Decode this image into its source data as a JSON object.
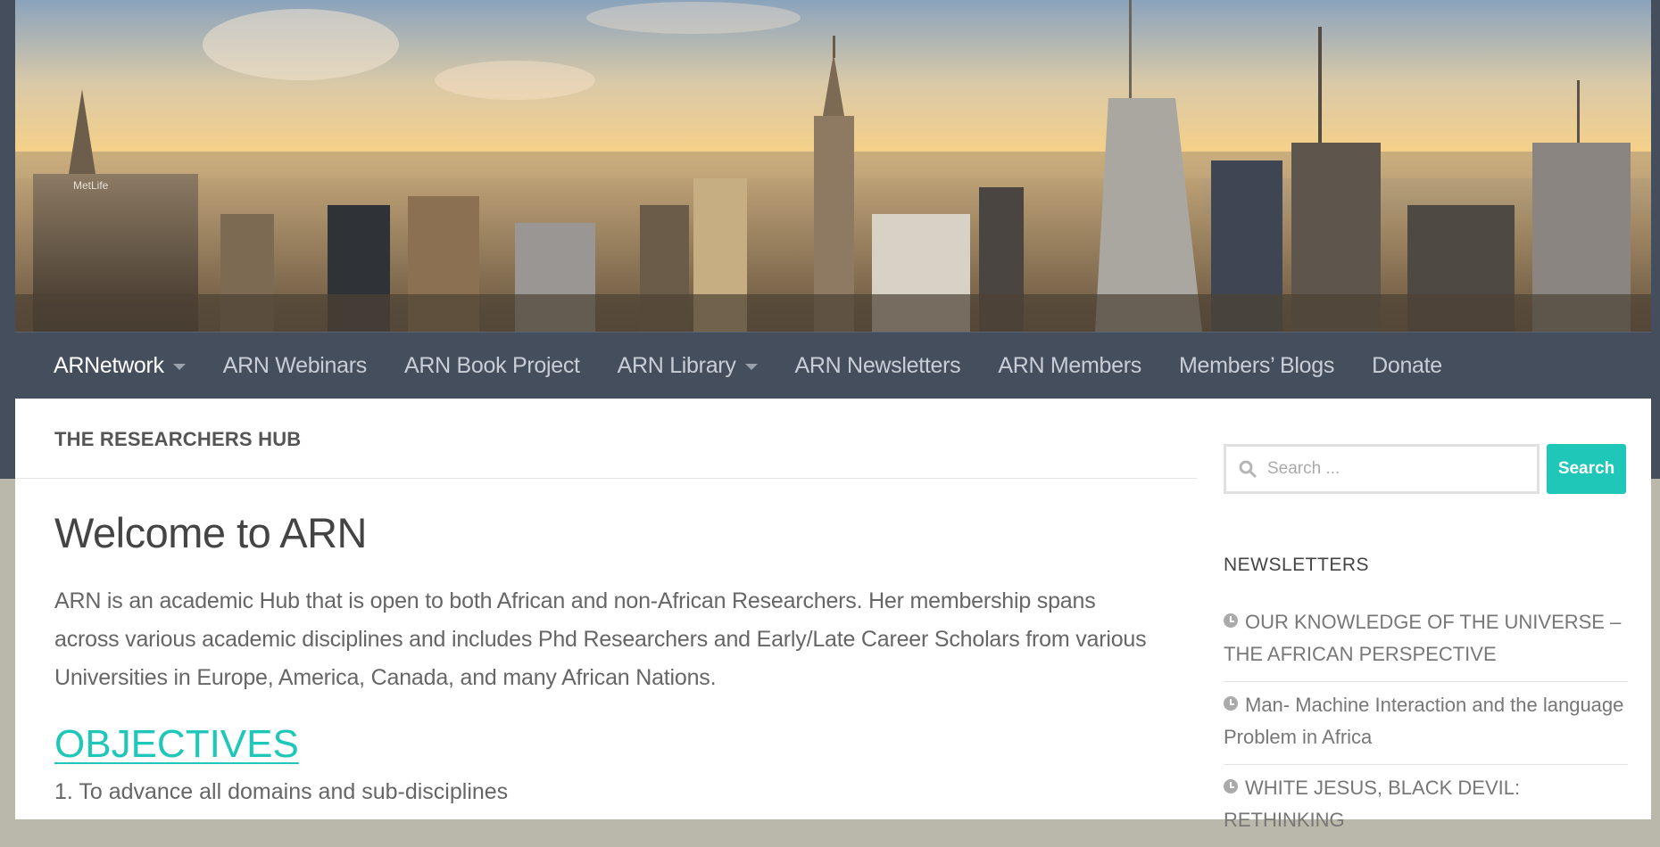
{
  "banner": {
    "logo_text": "MetLife"
  },
  "nav": {
    "items": [
      {
        "label": "ARNetwork",
        "dropdown": true,
        "active": true
      },
      {
        "label": "ARN Webinars",
        "dropdown": false
      },
      {
        "label": "ARN Book Project",
        "dropdown": false
      },
      {
        "label": "ARN Library",
        "dropdown": true
      },
      {
        "label": "ARN Newsletters",
        "dropdown": false
      },
      {
        "label": "ARN Members",
        "dropdown": false
      },
      {
        "label": "Members’ Blogs",
        "dropdown": false
      },
      {
        "label": "Donate",
        "dropdown": false
      }
    ]
  },
  "hub": {
    "title": "THE RESEARCHERS HUB"
  },
  "main": {
    "title": "Welcome to ARN",
    "intro": "ARN is an academic Hub that is open to both African and non-African Researchers. Her membership spans across various academic disciplines and  includes Phd Researchers and Early/Late Career Scholars from various Universities in Europe, America, Canada, and many African Nations.",
    "objectives_heading": "OBJECTIVES",
    "list_first": "1.  To advance all domains and sub-disciplines"
  },
  "sidebar": {
    "search": {
      "placeholder": "Search ...",
      "button": "Search"
    },
    "newsletters_title": "NEWSLETTERS",
    "newsletters": [
      "OUR KNOWLEDGE OF THE UNIVERSE – THE AFRICAN PERSPECTIVE",
      "Man- Machine Interaction and the language Problem in Africa",
      "WHITE JESUS, BLACK DEVIL: RETHINKING"
    ]
  },
  "colors": {
    "accent": "#1fc7b8",
    "nav_bg": "#454e5c"
  }
}
